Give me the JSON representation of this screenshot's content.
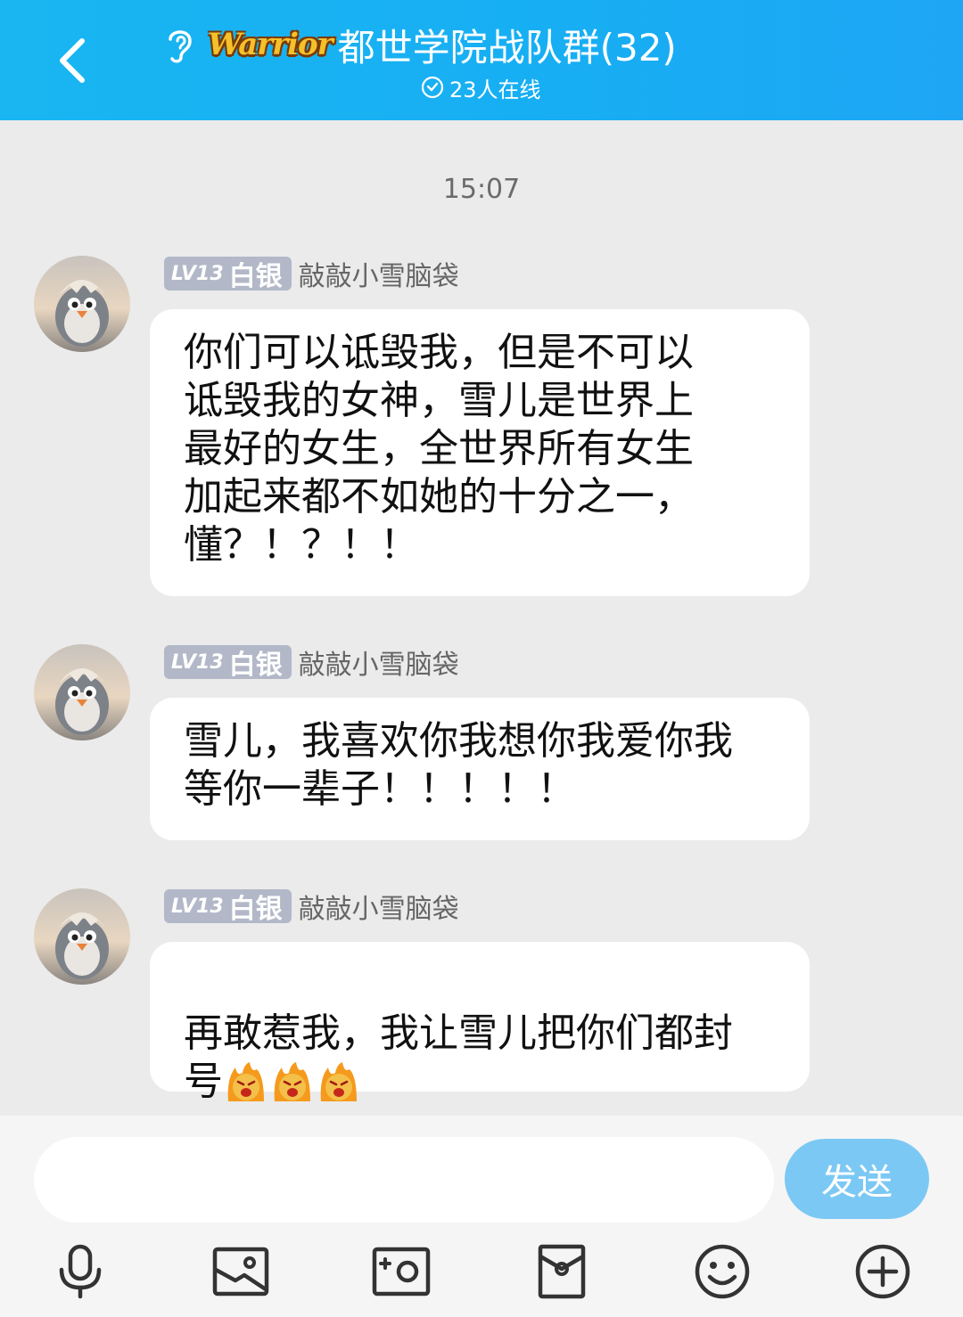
{
  "header": {
    "badge_text": "Warrior",
    "title": "都世学院战队群(32)",
    "online": "23人在线"
  },
  "chat": {
    "timestamp": "15:07",
    "messages": [
      {
        "level": "LV13",
        "rank": "白银",
        "nickname": "敲敲小雪脑袋",
        "text": "你们可以诋毁我，但是不可以\n诋毁我的女神，雪儿是世界上\n最好的女生，全世界所有女生\n加起来都不如她的十分之一，\n懂？！？！！"
      },
      {
        "level": "LV13",
        "rank": "白银",
        "nickname": "敲敲小雪脑袋",
        "text": "雪儿，我喜欢你我想你我爱你我\n等你一辈子！！！！！"
      },
      {
        "level": "LV13",
        "rank": "白银",
        "nickname": "敲敲小雪脑袋",
        "text": "再敢惹我，我让雪儿把你们都封\n号"
      }
    ]
  },
  "input": {
    "placeholder": "",
    "send_label": "发送"
  },
  "toolbar": [
    "microphone-icon",
    "image-icon",
    "camera-icon",
    "red-packet-icon",
    "emoji-icon",
    "plus-icon"
  ],
  "colors": {
    "header": "#19b6f2",
    "send_button": "#7cc8f4",
    "level_badge": "#b2b8c8"
  }
}
